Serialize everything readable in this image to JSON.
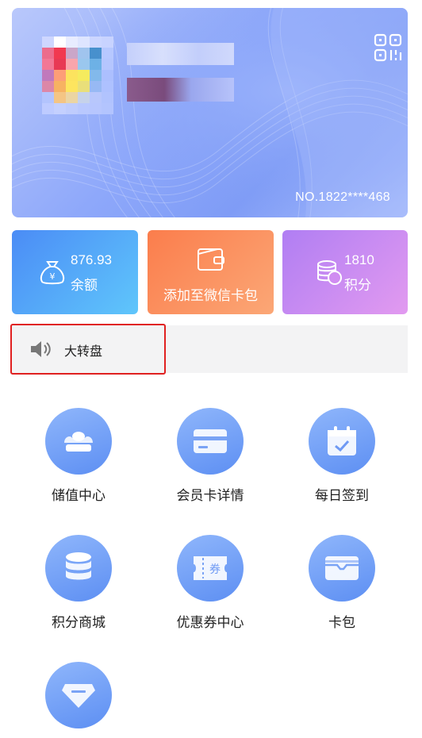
{
  "card": {
    "number": "NO.1822****468",
    "qr_icon": "qr-code-icon"
  },
  "tiles": {
    "balance": {
      "value": "876.93",
      "label": "余额",
      "icon": "money-bag-icon"
    },
    "wallet": {
      "label": "添加至微信卡包",
      "icon": "wallet-icon"
    },
    "points": {
      "value": "1810",
      "label": "积分",
      "icon": "coins-icon"
    }
  },
  "notice": {
    "text": "大转盘",
    "icon": "speaker-icon"
  },
  "menu": [
    {
      "label": "储值中心",
      "icon": "gold-ingot-icon"
    },
    {
      "label": "会员卡详情",
      "icon": "card-icon"
    },
    {
      "label": "每日签到",
      "icon": "calendar-check-icon"
    },
    {
      "label": "积分商城",
      "icon": "database-icon"
    },
    {
      "label": "优惠券中心",
      "icon": "coupon-icon"
    },
    {
      "label": "卡包",
      "icon": "card-holder-icon"
    },
    {
      "label": "",
      "icon": "diamond-icon"
    }
  ],
  "colors": {
    "accent_blue": "#5d8ff3",
    "balance_tile": "#4b8cf6",
    "wallet_tile": "#fb7d4c",
    "points_tile": "#b07ef3",
    "highlight_border": "#e02020"
  }
}
